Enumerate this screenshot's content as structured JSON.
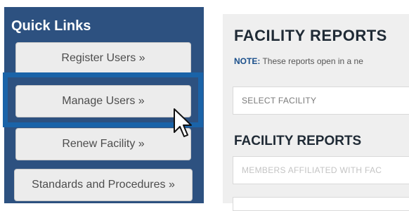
{
  "sidebar": {
    "title": "Quick Links",
    "links": [
      {
        "label": "Register Users »"
      },
      {
        "label": "Manage Users »"
      },
      {
        "label": "Renew Facility »"
      },
      {
        "label": "Standards and Procedures »"
      }
    ]
  },
  "main": {
    "title": "FACILITY REPORTS",
    "note_label": "NOTE:",
    "note_text": " These reports open in a ne",
    "facility_select_placeholder": "SELECT FACILITY",
    "section_title": "FACILITY REPORTS",
    "report_select_placeholder": "MEMBERS AFFILIATED WITH FAC"
  },
  "colors": {
    "sidebar_bg": "#2d5180",
    "highlight": "#1a63a8",
    "note_label": "#1a4f8b"
  },
  "icons": {
    "cursor": "mouse-pointer-icon"
  }
}
